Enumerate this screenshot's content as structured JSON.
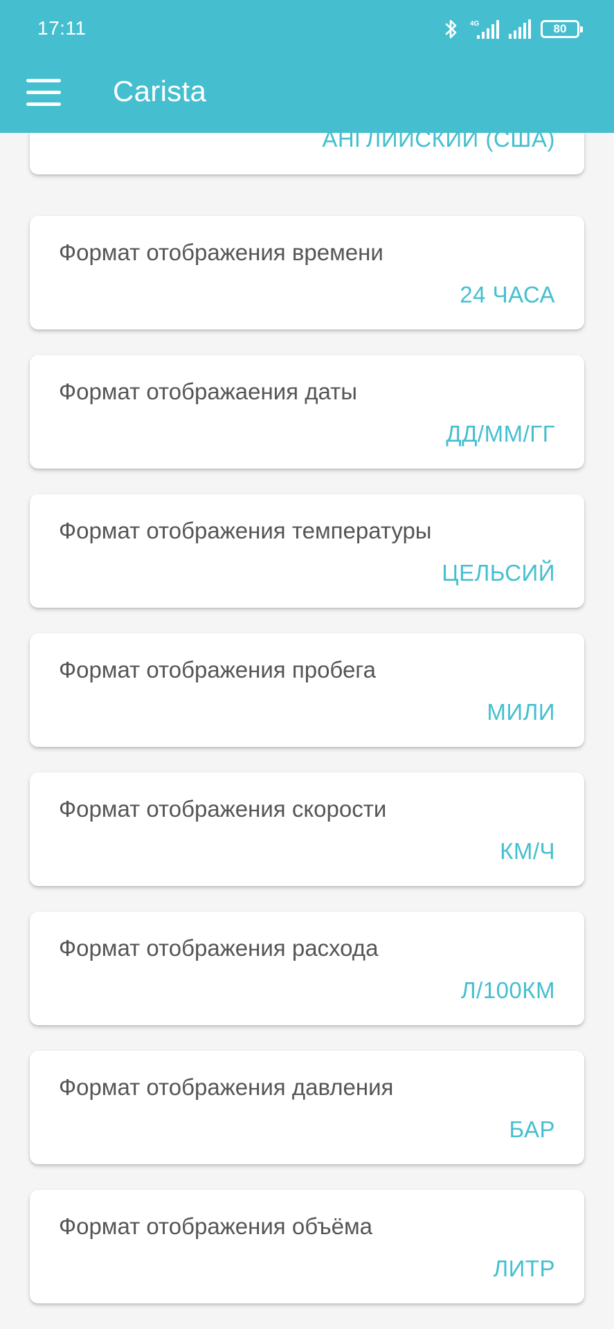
{
  "status_bar": {
    "time": "17:11",
    "network": "4G",
    "battery": "80"
  },
  "app_bar": {
    "title": "Carista"
  },
  "settings": [
    {
      "label": "",
      "value": "АНГЛИЙСКИЙ (США)"
    },
    {
      "label": "Формат отображения времени",
      "value": "24 ЧАСА"
    },
    {
      "label": "Формат отображаения даты",
      "value": "ДД/ММ/ГГ"
    },
    {
      "label": "Формат отображения температуры",
      "value": "ЦЕЛЬСИЙ"
    },
    {
      "label": "Формат отображения пробега",
      "value": "МИЛИ"
    },
    {
      "label": "Формат отображения скорости",
      "value": "КМ/Ч"
    },
    {
      "label": "Формат отображения расхода",
      "value": "Л/100КМ"
    },
    {
      "label": "Формат отображения давления",
      "value": "БАР"
    },
    {
      "label": "Формат отображения объёма",
      "value": "ЛИТР"
    }
  ],
  "colors": {
    "accent": "#45bfcf",
    "label_text": "#555555",
    "background": "#f5f5f5"
  }
}
